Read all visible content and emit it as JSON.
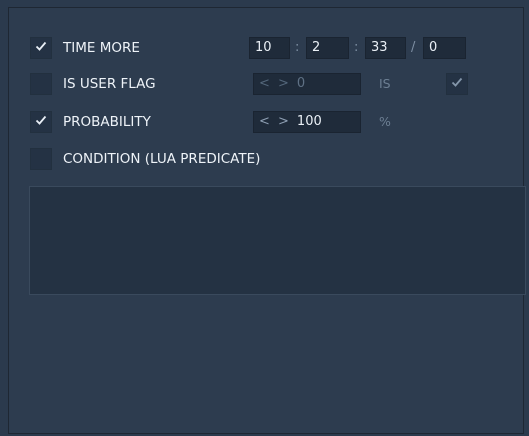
{
  "rows": {
    "time_more": {
      "label": "TIME MORE",
      "checked": true,
      "hours": "10",
      "minutes": "2",
      "seconds": "33",
      "frames": "0",
      "time_sep": ":",
      "frame_sep": "/"
    },
    "is_user_flag": {
      "label": "IS USER FLAG",
      "checked": false,
      "value_arrows": "< >",
      "value": "0",
      "is_label": "IS",
      "is_checked": true
    },
    "probability": {
      "label": "PROBABILITY",
      "checked": true,
      "value_arrows": "< >",
      "value": "100",
      "unit": "%"
    },
    "condition": {
      "label": "CONDITION (LUA PREDICATE)",
      "checked": false,
      "script": ""
    }
  },
  "icons": {
    "check": "check-icon"
  },
  "colors": {
    "background": "#2b3a4d",
    "panel": "#2d3c4f",
    "field": "#1f2b3a",
    "text": "#eef3f8",
    "muted": "#6d7f93"
  }
}
